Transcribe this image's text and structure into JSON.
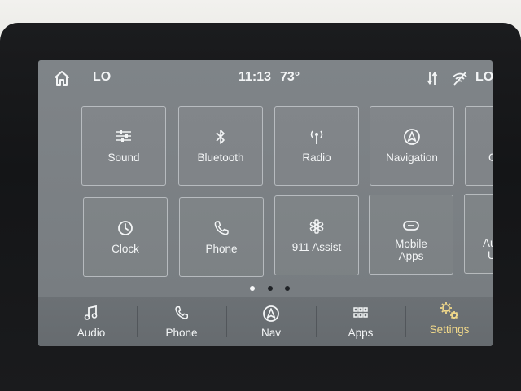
{
  "status_bar": {
    "left_fan": "LO",
    "time": "11:13",
    "temperature": "73°",
    "right_fan": "LO",
    "icons": [
      "home-icon",
      "sort-icon",
      "wifi-off-icon"
    ]
  },
  "tiles": [
    {
      "label": "Sound",
      "icon": "sliders-icon"
    },
    {
      "label": "Bluetooth",
      "icon": "bluetooth-icon"
    },
    {
      "label": "Radio",
      "icon": "antenna-icon"
    },
    {
      "label": "Navigation",
      "icon": "navigation-icon"
    },
    {
      "label": "G",
      "icon": "",
      "partial": true
    },
    {
      "label": "Clock",
      "icon": "clock-icon"
    },
    {
      "label": "Phone",
      "icon": "phone-icon"
    },
    {
      "label": "911 Assist",
      "icon": "asterisk-icon"
    },
    {
      "label": "Mobile Apps",
      "label_line1": "Mobile",
      "label_line2": "Apps",
      "icon": "mobile-apps-icon"
    },
    {
      "label": "Au U",
      "label_line1": "Au",
      "label_line2": "U",
      "icon": "",
      "partial": true
    }
  ],
  "pager": {
    "pages": 3,
    "active": 1
  },
  "nav": [
    {
      "label": "Audio",
      "icon": "music-icon"
    },
    {
      "label": "Phone",
      "icon": "phone-icon"
    },
    {
      "label": "Nav",
      "icon": "navigation-icon"
    },
    {
      "label": "Apps",
      "icon": "grid-icon"
    },
    {
      "label": "Settings",
      "icon": "gears-icon",
      "active": true
    }
  ],
  "colors": {
    "settings_active": "#f2d98a",
    "screen_bg": "#7b8084"
  }
}
